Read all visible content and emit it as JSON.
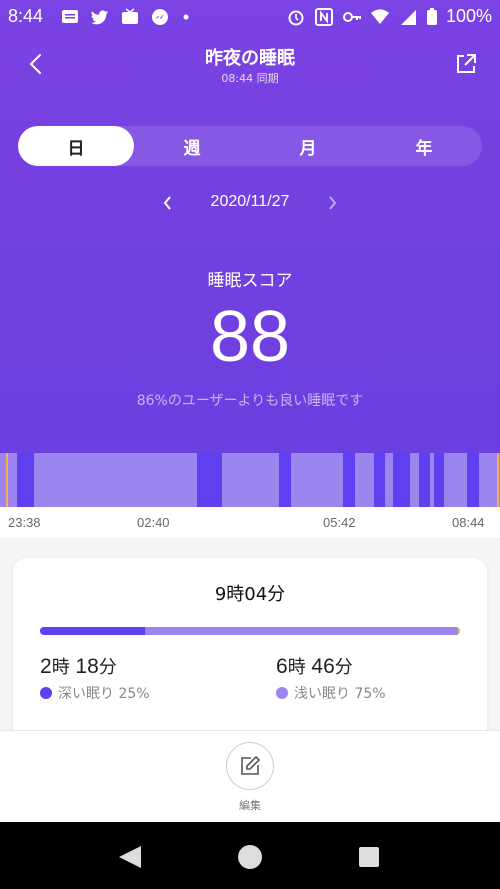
{
  "status_bar": {
    "time": "8:44",
    "battery": "100%",
    "left_icons": [
      "message-icon",
      "twitter-icon",
      "tv-icon",
      "messenger-icon",
      "dot-icon"
    ],
    "right_icons": [
      "alarm-icon",
      "nfc-icon",
      "key-icon",
      "wifi-icon",
      "signal-icon",
      "battery-icon"
    ]
  },
  "header": {
    "title": "昨夜の睡眠",
    "subtitle": "08:44 同期"
  },
  "tabs": [
    {
      "label": "日",
      "active": true
    },
    {
      "label": "週",
      "active": false
    },
    {
      "label": "月",
      "active": false
    },
    {
      "label": "年",
      "active": false
    }
  ],
  "date_nav": {
    "date": "2020/11/27"
  },
  "score": {
    "label": "睡眠スコア",
    "value": "88",
    "description": "86%のユーザーよりも良い睡眠です"
  },
  "timeline": {
    "ticks": [
      "23:38",
      "02:40",
      "05:42",
      "08:44"
    ],
    "deep_color": "#5f3ff0",
    "light_color": "#9c85ee",
    "marker_color": "#f5b14a"
  },
  "summary": {
    "total": "9時04分",
    "deep_fraction": 0.25,
    "deep": {
      "hours": "2",
      "h_unit": "時",
      "minutes": "18",
      "m_unit": "分",
      "label": "深い眠り 25%"
    },
    "light": {
      "hours": "6",
      "h_unit": "時",
      "minutes": "46",
      "m_unit": "分",
      "label": "浅い眠り 75%"
    }
  },
  "actions": {
    "edit_label": "編集"
  },
  "colors": {
    "accent": "#7440e0",
    "deep": "#5f3ff0",
    "light": "#9c85ee"
  }
}
